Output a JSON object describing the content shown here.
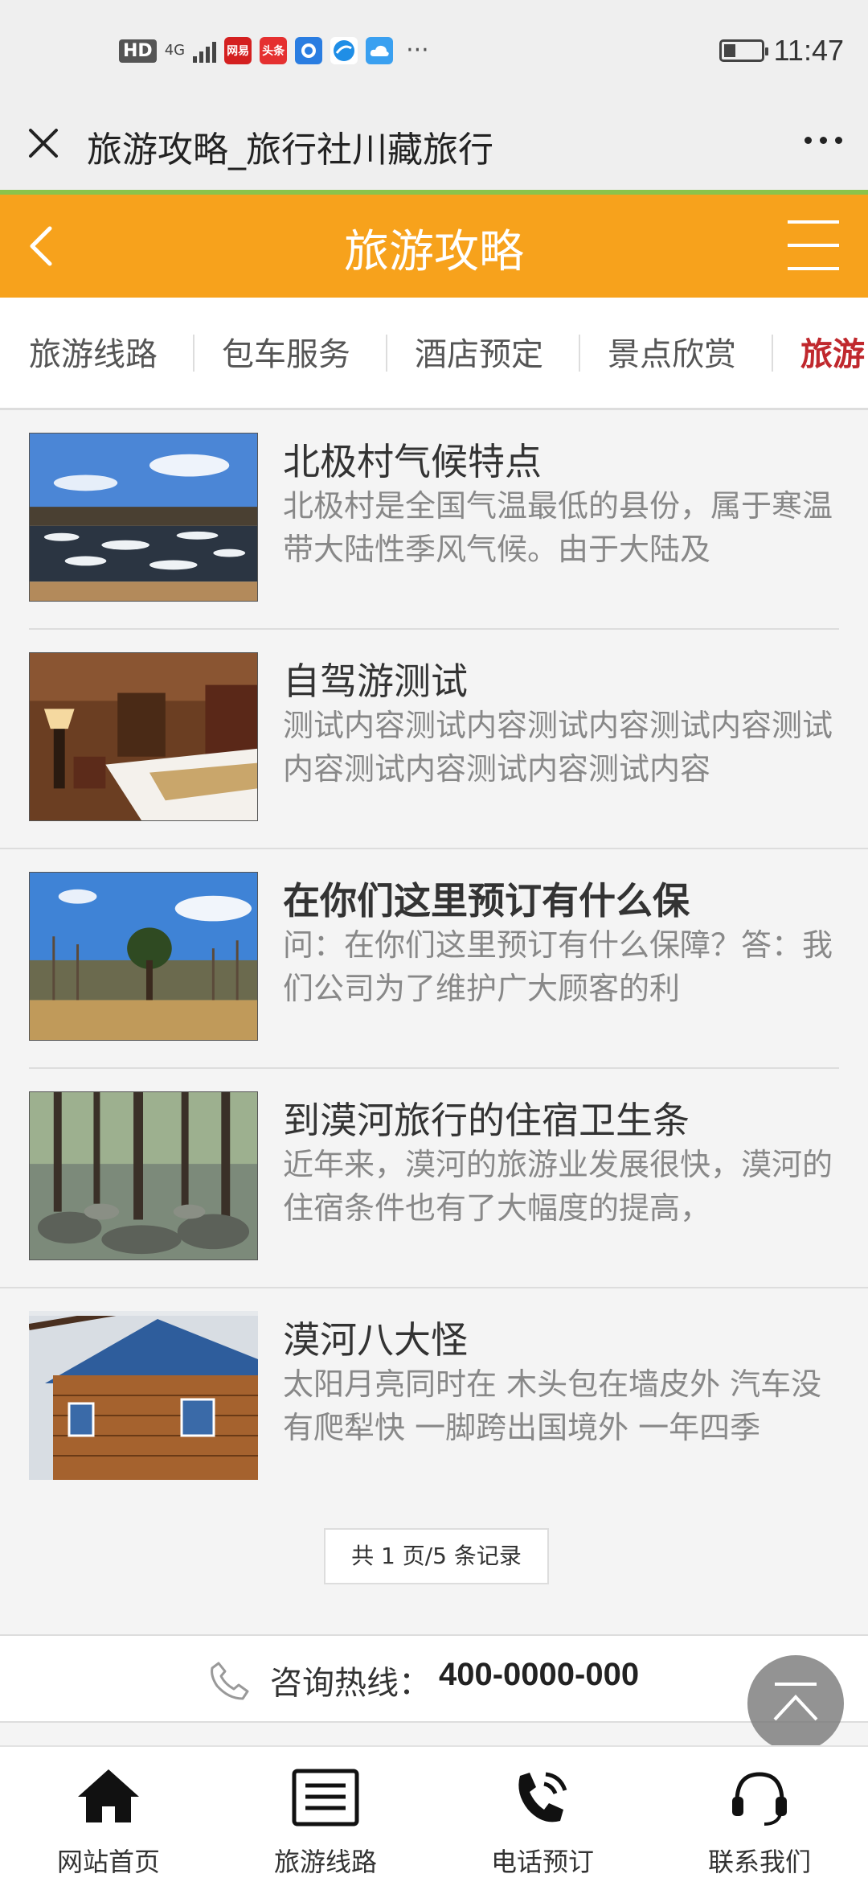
{
  "status_bar": {
    "hd": "HD",
    "network": "4G",
    "apps": [
      {
        "icon": "netease-app-icon",
        "text": "网易",
        "color": "#d42020"
      },
      {
        "icon": "toutiao-app-icon",
        "text": "头条",
        "color": "#e53030"
      },
      {
        "icon": "qq-app-icon",
        "text": "",
        "color": "#2a7de1"
      },
      {
        "icon": "browser-app-icon",
        "text": "",
        "color": "#1f8ee6"
      },
      {
        "icon": "cloud-app-icon",
        "text": "",
        "color": "#3aa0f0"
      }
    ],
    "more": "···",
    "time": "11:47"
  },
  "browser": {
    "title": "旅游攻略_旅行社川藏旅行"
  },
  "header": {
    "title": "旅游攻略",
    "color": "#f7a21c"
  },
  "category_nav": {
    "items": [
      {
        "label": "旅游线路"
      },
      {
        "label": "包车服务"
      },
      {
        "label": "酒店预定"
      },
      {
        "label": "景点欣赏"
      },
      {
        "label": "旅游",
        "active": true
      }
    ],
    "active_color": "#c0282d"
  },
  "articles": [
    {
      "title": "北极村气候特点",
      "desc": "北极村是全国气温最低的县份，属于寒温带大陆性季风气候。由于大陆及",
      "image": "frozen-river-image"
    },
    {
      "title": "自驾游测试",
      "desc": "测试内容测试内容测试内容测试内容测试内容测试内容测试内容测试内容",
      "image": "hotel-room-image"
    },
    {
      "title": "在你们这里预订有什么保",
      "desc": "问：在你们这里预订有什么保障？答：我们公司为了维护广大顾客的利",
      "image": "meadow-trees-image"
    },
    {
      "title": "到漠河旅行的住宿卫生条",
      "desc": "近年来，漠河的旅游业发展很快，漠河的住宿条件也有了大幅度的提高，",
      "image": "forest-rocks-image"
    },
    {
      "title": "漠河八大怪",
      "desc": "太阳月亮同时在 木头包在墙皮外 汽车没有爬犁快 一脚跨出国境外 一年四季",
      "image": "log-cabin-image"
    }
  ],
  "pager": {
    "text": "共 1 页/5 条记录"
  },
  "hotline": {
    "label": "咨询热线：",
    "number": "400-0000-000"
  },
  "bottom_nav": [
    {
      "label": "网站首页",
      "icon": "home-icon"
    },
    {
      "label": "旅游线路",
      "icon": "list-icon"
    },
    {
      "label": "电话预订",
      "icon": "phone-icon"
    },
    {
      "label": "联系我们",
      "icon": "headset-icon"
    }
  ]
}
